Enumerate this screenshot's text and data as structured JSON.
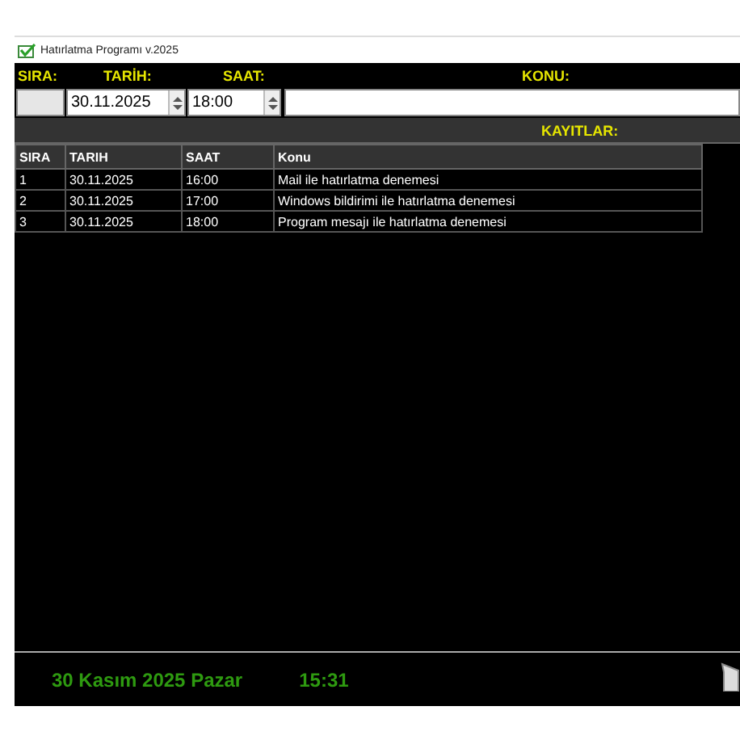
{
  "window": {
    "title": "Hatırlatma Programı v.2025"
  },
  "form": {
    "labels": [
      "SIRA:",
      "TARİH:",
      "SAAT:",
      "KONU:"
    ],
    "sira": {
      "disabled": true
    },
    "date": "30.11.2025",
    "time": "18:00"
  },
  "records_title": "KAYITLAR:",
  "table": {
    "columns": [
      "SIRA",
      "TARIH",
      "SAAT",
      "Konu"
    ],
    "rows": [
      [
        "1",
        "30.11.2025",
        "16:00",
        "Mail ile hatırlatma denemesi"
      ],
      [
        "2",
        "30.11.2025",
        "17:00",
        "Windows bildirimi ile hatırlatma denemesi"
      ],
      [
        "3",
        "30.11.2025",
        "18:00",
        "Program mesajı ile hatırlatma denemesi"
      ]
    ]
  },
  "status_bar": {
    "date": "30 Kasım 2025 Pazar",
    "time": "15:31"
  }
}
